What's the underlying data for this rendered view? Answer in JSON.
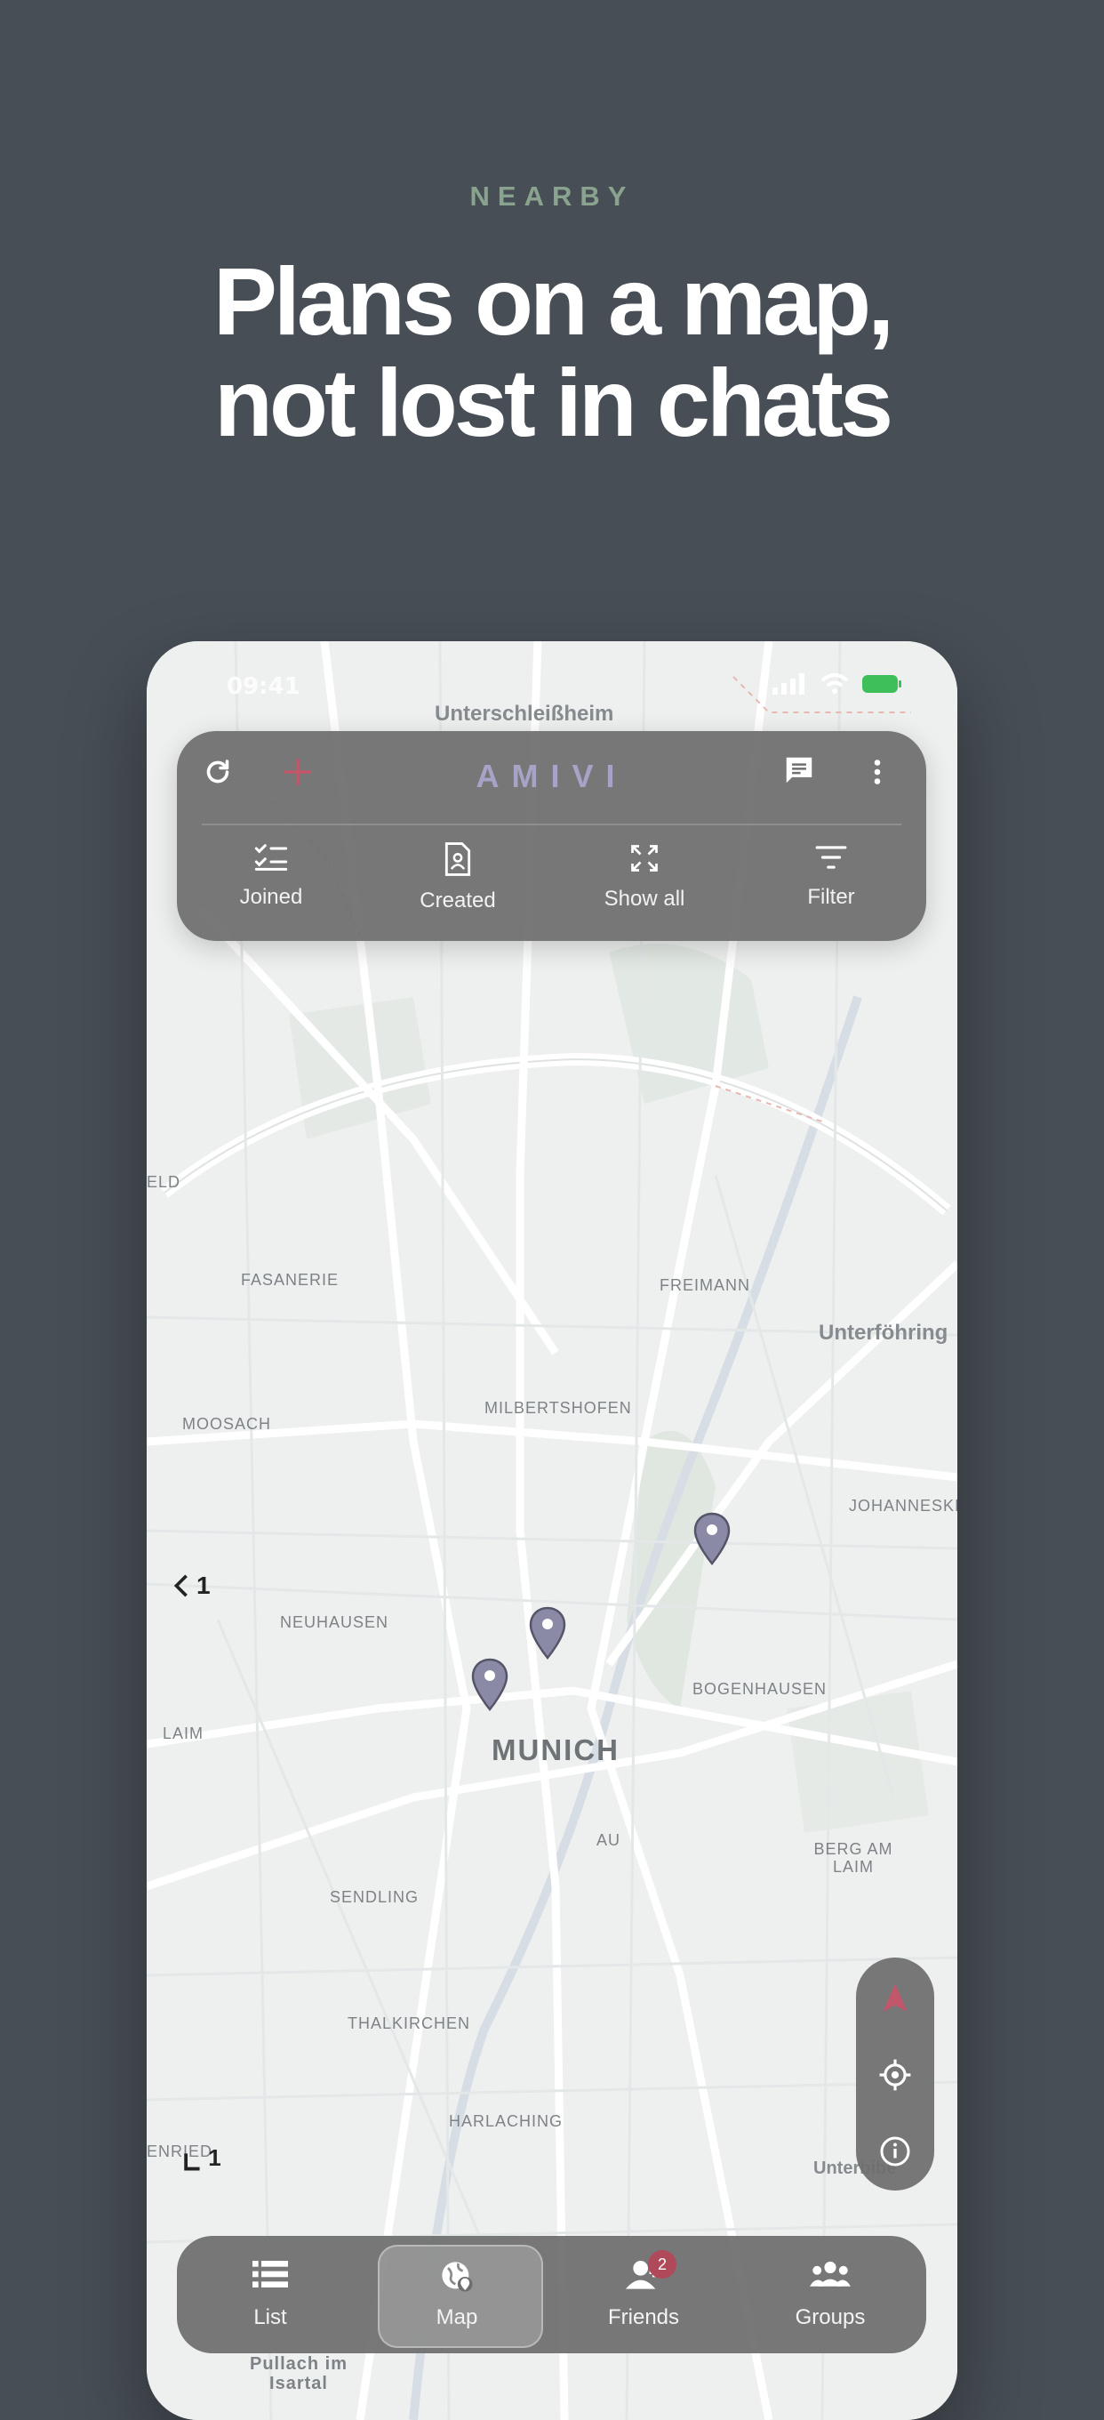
{
  "header": {
    "eyebrow": "NEARBY",
    "headline_line1": "Plans on a map,",
    "headline_line2": "not lost in chats"
  },
  "status_bar": {
    "time": "09:41"
  },
  "top_bar": {
    "brand": "AMIVI",
    "accent_color": "#c2566a",
    "brand_color": "#a6a3c6",
    "actions": [
      {
        "label": "Joined",
        "icon": "checklist-icon"
      },
      {
        "label": "Created",
        "icon": "document-person-icon"
      },
      {
        "label": "Show all",
        "icon": "expand-icon"
      },
      {
        "label": "Filter",
        "icon": "filter-icon"
      }
    ]
  },
  "map": {
    "labels": {
      "unterschleissheim": "Unterschleißheim",
      "fasanerie": "FASANERIE",
      "freimann": "FREIMANN",
      "unterfoehring": "Unterföhring",
      "moosach": "MOOSACH",
      "milbertshofen": "MILBERTSHOFEN",
      "johanneskirchen": "JOHANNESKIR",
      "neuhausen": "NEUHAUSEN",
      "bogenhausen": "BOGENHAUSEN",
      "munich": "MUNICH",
      "laim": "LAIM",
      "au": "AU",
      "berg_am_laim": "BERG AM LAIM",
      "sendling": "SENDLING",
      "thalkirchen": "THALKIRCHEN",
      "harlaching": "HARLACHING",
      "unterbiberg": "Unterbibe",
      "pullach": "Pullach im Isartal",
      "feld": "ELD",
      "enried": "ENRIED"
    },
    "cluster_left": "1",
    "cluster_bottom": "1",
    "marker_color": "#8a8aa6"
  },
  "tabs": [
    {
      "label": "List",
      "icon": "list-icon",
      "active": false
    },
    {
      "label": "Map",
      "icon": "globe-pin-icon",
      "active": true
    },
    {
      "label": "Friends",
      "icon": "person-icon",
      "active": false,
      "badge": "2"
    },
    {
      "label": "Groups",
      "icon": "group-icon",
      "active": false
    }
  ]
}
